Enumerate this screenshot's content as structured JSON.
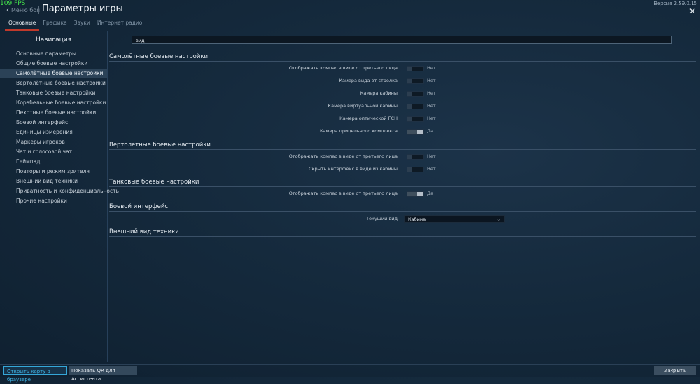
{
  "overlay": {
    "fps": "109 FPS",
    "version": "Версия 2.59.0.15"
  },
  "header": {
    "back_label": "Меню боя",
    "title": "Параметры игры",
    "tabs": [
      {
        "label": "Основные",
        "active": true
      },
      {
        "label": "Графика"
      },
      {
        "label": "Звуки"
      },
      {
        "label": "Интернет радио"
      }
    ]
  },
  "nav": {
    "heading": "Навигация",
    "items": [
      {
        "label": "Основные параметры"
      },
      {
        "label": "Общие боевые настройки"
      },
      {
        "label": "Самолётные боевые настройки",
        "selected": true
      },
      {
        "label": "Вертолётные боевые настройки"
      },
      {
        "label": "Танковые боевые настройки"
      },
      {
        "label": "Корабельные боевые настройки"
      },
      {
        "label": "Пехотные боевые настройки"
      },
      {
        "label": "Боевой интерфейс"
      },
      {
        "label": "Единицы измерения"
      },
      {
        "label": "Маркеры игроков"
      },
      {
        "label": "Чат и голосовой чат"
      },
      {
        "label": "Геймпад"
      },
      {
        "label": "Повторы и режим зрителя"
      },
      {
        "label": "Внешний вид техники"
      },
      {
        "label": "Приватность и конфиденциальность"
      },
      {
        "label": "Прочие настройки"
      }
    ]
  },
  "search": {
    "value": "вид"
  },
  "sections": {
    "aircraft": {
      "title": "Самолётные боевые настройки",
      "rows": [
        {
          "label": "Отображать компас в виде от третьего лица",
          "value": "Нет",
          "on": false
        },
        {
          "label": "Камера вида от стрелка",
          "value": "Нет",
          "on": false
        },
        {
          "label": "Камера кабины",
          "value": "Нет",
          "on": false
        },
        {
          "label": "Камера виртуальной кабины",
          "value": "Нет",
          "on": false
        },
        {
          "label": "Камера оптической ГСН",
          "value": "Нет",
          "on": false
        },
        {
          "label": "Камера прицельного комплекса",
          "value": "Да",
          "on": true
        }
      ]
    },
    "helicopter": {
      "title": "Вертолётные боевые настройки",
      "rows": [
        {
          "label": "Отображать компас в виде от третьего лица",
          "value": "Нет",
          "on": false
        },
        {
          "label": "Скрыть интерфейс в виде из кабины",
          "value": "Нет",
          "on": false
        }
      ]
    },
    "tank": {
      "title": "Танковые боевые настройки",
      "rows": [
        {
          "label": "Отображать компас в виде от третьего лица",
          "value": "Да",
          "on": true
        }
      ]
    },
    "combat_ui": {
      "title": "Боевой интерфейс",
      "current_view_label": "Текущий вид",
      "current_view_value": "Кабина"
    },
    "vehicle_appearance": {
      "title": "Внешний вид техники"
    }
  },
  "footer": {
    "open_map_label": "Открыть карту в браузере",
    "show_qr_label": "Показать QR для Ассистента",
    "close_label": "Закрыть"
  }
}
